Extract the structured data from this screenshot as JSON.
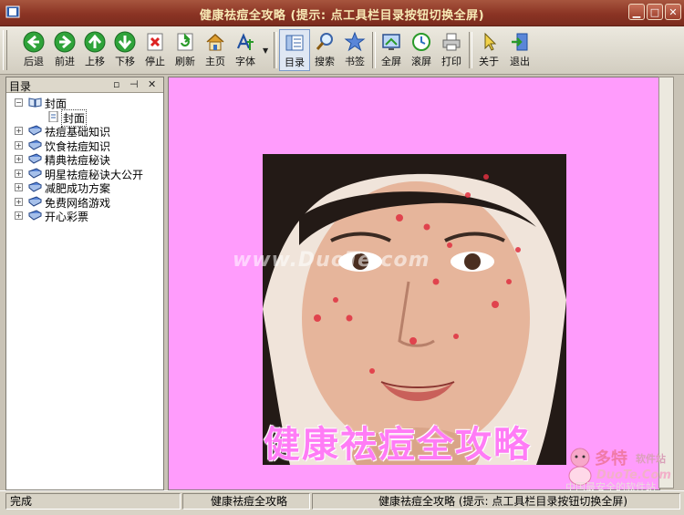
{
  "window": {
    "title": "健康祛痘全攻略 (提示: 点工具栏目录按钮切换全屏)"
  },
  "toolbar": {
    "items": [
      {
        "label": "后退",
        "icon": "back-arrow-icon"
      },
      {
        "label": "前进",
        "icon": "forward-arrow-icon"
      },
      {
        "label": "上移",
        "icon": "up-arrow-icon"
      },
      {
        "label": "下移",
        "icon": "down-arrow-icon"
      },
      {
        "label": "停止",
        "icon": "stop-icon"
      },
      {
        "label": "刷新",
        "icon": "refresh-icon"
      },
      {
        "label": "主页",
        "icon": "home-icon"
      },
      {
        "label": "字体",
        "icon": "font-icon"
      },
      {
        "label": "目录",
        "icon": "contents-icon"
      },
      {
        "label": "搜索",
        "icon": "search-icon"
      },
      {
        "label": "书签",
        "icon": "bookmark-icon"
      },
      {
        "label": "全屏",
        "icon": "fullscreen-icon"
      },
      {
        "label": "滚屏",
        "icon": "autoscroll-icon"
      },
      {
        "label": "打印",
        "icon": "print-icon"
      },
      {
        "label": "关于",
        "icon": "about-icon"
      },
      {
        "label": "退出",
        "icon": "exit-icon"
      }
    ]
  },
  "sidebar": {
    "title": "目录",
    "tree": [
      {
        "label": "封面",
        "expanded": true,
        "children": [
          {
            "label": "封面",
            "selected": true
          }
        ]
      },
      {
        "label": "祛痘基础知识"
      },
      {
        "label": "饮食祛痘知识"
      },
      {
        "label": "精典祛痘秘诀"
      },
      {
        "label": "明星祛痘秘诀大公开"
      },
      {
        "label": "减肥成功方案"
      },
      {
        "label": "免费网络游戏"
      },
      {
        "label": "开心彩票"
      }
    ]
  },
  "content": {
    "cover_title": "健康祛痘全攻略",
    "watermark": "www.DuoTe.com",
    "background": "#ff9cfc"
  },
  "logo": {
    "name": "多特",
    "tag": "软件站",
    "url": "DuoTe.Com",
    "slogan": "中国最安全的软件站"
  },
  "statusbar": {
    "left": "完成",
    "middle": "健康祛痘全攻略",
    "right": "健康祛痘全攻略 (提示: 点工具栏目录按钮切换全屏)"
  }
}
